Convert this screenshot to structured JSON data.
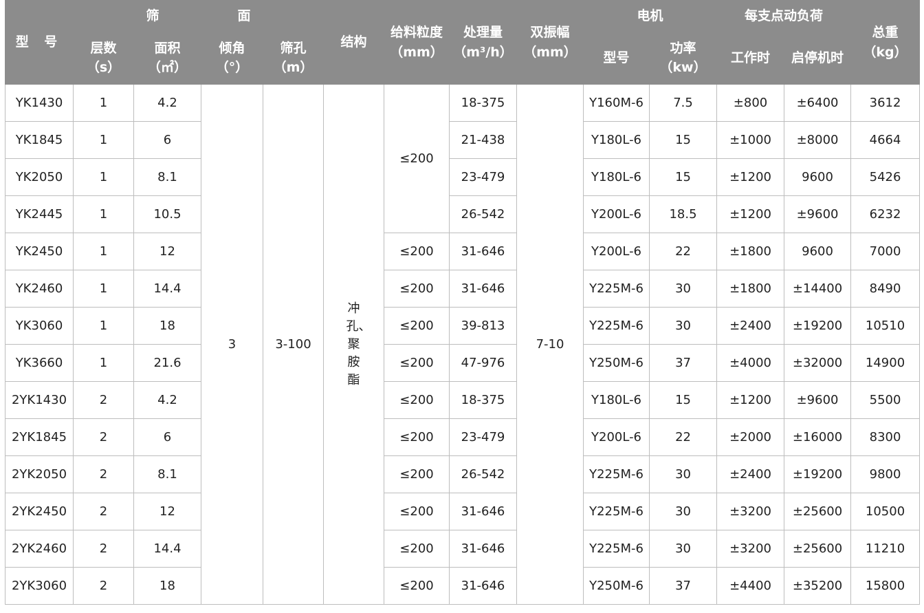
{
  "headers": {
    "model": "型 号",
    "screen_group": "筛　　　　　　面",
    "layers": "层数",
    "layers_unit": "（s）",
    "area": "面积",
    "area_unit": "（㎡）",
    "angle": "倾角",
    "angle_unit": "（°）",
    "hole": "筛孔",
    "hole_unit": "（m）",
    "structure": "结构",
    "feed": "给料粒度",
    "feed_unit": "（mm）",
    "capacity": "处理量",
    "capacity_unit": "（m³/h）",
    "amplitude": "双振幅",
    "amplitude_unit": "（mm）",
    "motor_group": "电机",
    "motor_model": "型号",
    "power": "功率",
    "power_unit": "（kw）",
    "load_group": "每支点动负荷",
    "work": "工作时",
    "startstop": "启停机时",
    "weight": "总重",
    "weight_unit": "（kg）"
  },
  "merged": {
    "angle": "3",
    "hole": "3-100",
    "structure": "冲孔、聚胺酯",
    "feed_first": "≤200",
    "amplitude": "7-10"
  },
  "rows": [
    {
      "model": "YK1430",
      "layers": "1",
      "area": "4.2",
      "feed": "",
      "capacity": "18-375",
      "motor": "Y160M-6",
      "power": "7.5",
      "work": "±800",
      "startstop": "±6400",
      "weight": "3612"
    },
    {
      "model": "YK1845",
      "layers": "1",
      "area": "6",
      "feed": "",
      "capacity": "21-438",
      "motor": "Y180L-6",
      "power": "15",
      "work": "±1000",
      "startstop": "±8000",
      "weight": "4664"
    },
    {
      "model": "YK2050",
      "layers": "1",
      "area": "8.1",
      "feed": "",
      "capacity": "23-479",
      "motor": "Y180L-6",
      "power": "15",
      "work": "±1200",
      "startstop": "9600",
      "weight": "5426"
    },
    {
      "model": "YK2445",
      "layers": "1",
      "area": "10.5",
      "feed": "",
      "capacity": "26-542",
      "motor": "Y200L-6",
      "power": "18.5",
      "work": "±1200",
      "startstop": "±9600",
      "weight": "6232"
    },
    {
      "model": "YK2450",
      "layers": "1",
      "area": "12",
      "feed": "≤200",
      "capacity": "31-646",
      "motor": "Y200L-6",
      "power": "22",
      "work": "±1800",
      "startstop": "9600",
      "weight": "7000"
    },
    {
      "model": "YK2460",
      "layers": "1",
      "area": "14.4",
      "feed": "≤200",
      "capacity": "31-646",
      "motor": "Y225M-6",
      "power": "30",
      "work": "±1800",
      "startstop": "±14400",
      "weight": "8490"
    },
    {
      "model": "YK3060",
      "layers": "1",
      "area": "18",
      "feed": "≤200",
      "capacity": "39-813",
      "motor": "Y225M-6",
      "power": "30",
      "work": "±2400",
      "startstop": "±19200",
      "weight": "10510"
    },
    {
      "model": "YK3660",
      "layers": "1",
      "area": "21.6",
      "feed": "≤200",
      "capacity": "47-976",
      "motor": "Y250M-6",
      "power": "37",
      "work": "±4000",
      "startstop": "±32000",
      "weight": "14900"
    },
    {
      "model": "2YK1430",
      "layers": "2",
      "area": "4.2",
      "feed": "≤200",
      "capacity": "18-375",
      "motor": "Y180L-6",
      "power": "15",
      "work": "±1200",
      "startstop": "±9600",
      "weight": "5500"
    },
    {
      "model": "2YK1845",
      "layers": "2",
      "area": "6",
      "feed": "≤200",
      "capacity": "23-479",
      "motor": "Y200L-6",
      "power": "22",
      "work": "±2000",
      "startstop": "±16000",
      "weight": "8300"
    },
    {
      "model": "2YK2050",
      "layers": "2",
      "area": "8.1",
      "feed": "≤200",
      "capacity": "26-542",
      "motor": "Y225M-6",
      "power": "30",
      "work": "±2400",
      "startstop": "±19200",
      "weight": "9800"
    },
    {
      "model": "2YK2450",
      "layers": "2",
      "area": "12",
      "feed": "≤200",
      "capacity": "31-646",
      "motor": "Y225M-6",
      "power": "30",
      "work": "±3200",
      "startstop": "±25600",
      "weight": "10500"
    },
    {
      "model": "2YK2460",
      "layers": "2",
      "area": "14.4",
      "feed": "≤200",
      "capacity": "31-646",
      "motor": "Y225M-6",
      "power": "30",
      "work": "±3200",
      "startstop": "±25600",
      "weight": "11210"
    },
    {
      "model": "2YK3060",
      "layers": "2",
      "area": "18",
      "feed": "≤200",
      "capacity": "31-646",
      "motor": "Y250M-6",
      "power": "37",
      "work": "±4400",
      "startstop": "±35200",
      "weight": "15800"
    }
  ]
}
